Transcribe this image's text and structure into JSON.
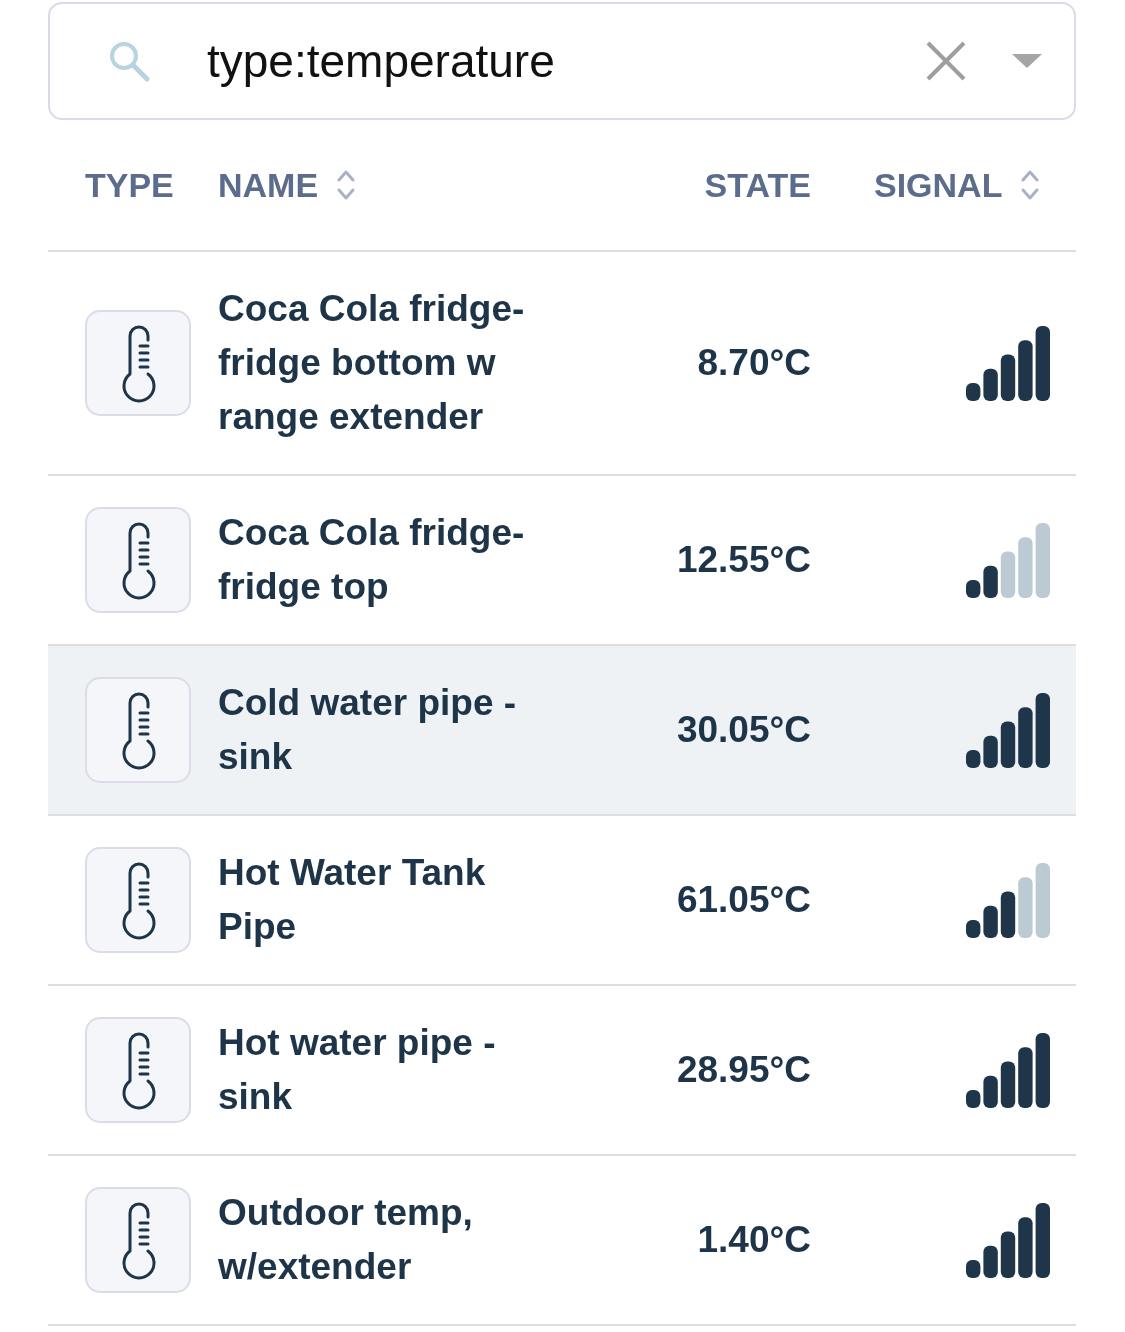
{
  "search": {
    "value": "type:temperature"
  },
  "columns": [
    {
      "label": "TYPE",
      "sortable": false
    },
    {
      "label": "NAME",
      "sortable": true
    },
    {
      "label": "STATE",
      "sortable": false
    },
    {
      "label": "SIGNAL",
      "sortable": true
    }
  ],
  "rows": [
    {
      "name": "Coca Cola fridge-fridge bottom w range extender",
      "state": "8.70°C",
      "signal_bars": [
        {
          "on": true
        },
        {
          "on": true
        },
        {
          "on": true
        },
        {
          "on": true
        },
        {
          "on": true
        }
      ],
      "selected": false
    },
    {
      "name": "Coca Cola fridge-fridge top",
      "state": "12.55°C",
      "signal_bars": [
        {
          "on": true
        },
        {
          "on": true
        },
        {
          "on": false
        },
        {
          "on": false
        },
        {
          "on": false
        }
      ],
      "selected": false
    },
    {
      "name": "Cold water pipe - sink",
      "state": "30.05°C",
      "signal_bars": [
        {
          "on": true
        },
        {
          "on": true
        },
        {
          "on": true
        },
        {
          "on": true
        },
        {
          "on": true
        }
      ],
      "selected": true
    },
    {
      "name": "Hot Water Tank Pipe",
      "state": "61.05°C",
      "signal_bars": [
        {
          "on": true
        },
        {
          "on": true
        },
        {
          "on": true
        },
        {
          "on": false
        },
        {
          "on": false
        }
      ],
      "selected": false
    },
    {
      "name": "Hot water pipe - sink",
      "state": "28.95°C",
      "signal_bars": [
        {
          "on": true
        },
        {
          "on": true
        },
        {
          "on": true
        },
        {
          "on": true
        },
        {
          "on": true
        }
      ],
      "selected": false
    },
    {
      "name": "Outdoor temp, w/extender",
      "state": "1.40°C",
      "signal_bars": [
        {
          "on": true
        },
        {
          "on": true
        },
        {
          "on": true
        },
        {
          "on": true
        },
        {
          "on": true
        }
      ],
      "selected": false
    }
  ]
}
